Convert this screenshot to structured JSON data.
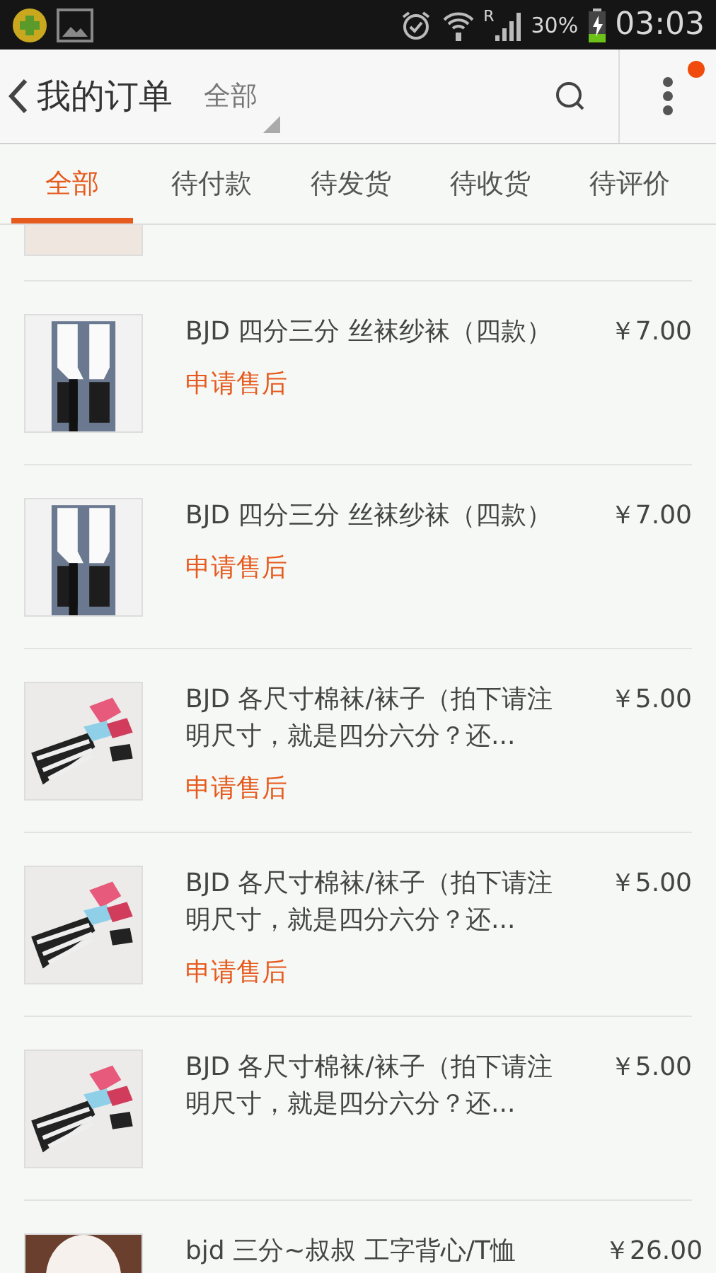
{
  "status_bar": {
    "roaming": "R",
    "battery": "30%",
    "time": "03:03"
  },
  "header": {
    "title": "我的订单",
    "filter": "全部",
    "has_notification": true
  },
  "tabs": [
    {
      "label": "全部",
      "selected": true
    },
    {
      "label": "待付款",
      "selected": false
    },
    {
      "label": "待发货",
      "selected": false
    },
    {
      "label": "待收货",
      "selected": false
    },
    {
      "label": "待评价",
      "selected": false
    }
  ],
  "orders": [
    {
      "thumbnail": {
        "kind": "picture"
      }
    },
    {
      "thumbnail": {
        "kind": "picture"
      },
      "title": "BJD 四分三分 丝袜纱袜（四款）",
      "price": "￥7.00",
      "action": "申请售后"
    },
    {
      "thumbnail": {
        "kind": "picture"
      },
      "title": "BJD 四分三分 丝袜纱袜（四款）",
      "price": "￥7.00",
      "action": "申请售后"
    },
    {
      "thumbnail": {
        "kind": "picture"
      },
      "title": "BJD 各尺寸棉袜/袜子（拍下请注明尺寸，就是四分六分？还...",
      "price": "￥5.00",
      "action": "申请售后"
    },
    {
      "thumbnail": {
        "kind": "picture"
      },
      "title": "BJD 各尺寸棉袜/袜子（拍下请注明尺寸，就是四分六分？还...",
      "price": "￥5.00",
      "action": "申请售后"
    },
    {
      "thumbnail": {
        "kind": "picture"
      },
      "title": "BJD 各尺寸棉袜/袜子（拍下请注明尺寸，就是四分六分？还...",
      "price": "￥5.00"
    },
    {
      "thumbnail": {
        "kind": "picture"
      },
      "title": "bjd 三分~叔叔 工字背心/T恤",
      "price": "￥26.00"
    }
  ]
}
